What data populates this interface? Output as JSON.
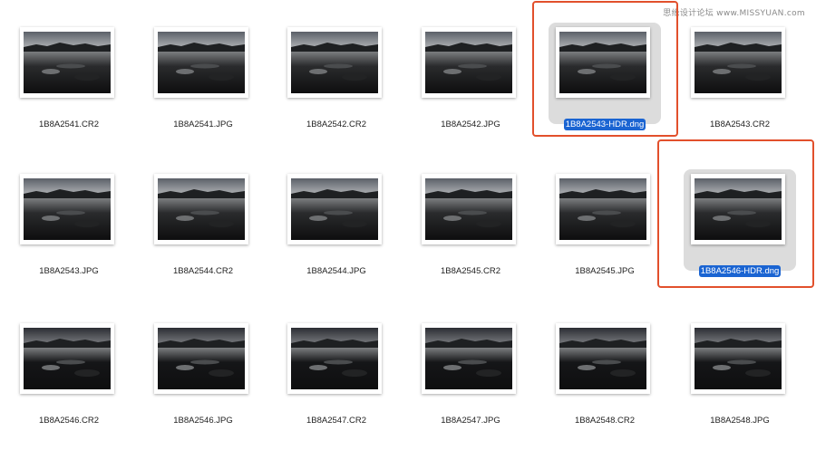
{
  "watermark": "思缘设计论坛 www.MISSYUAN.com",
  "files": [
    {
      "name": "1B8A2541.CR2",
      "selected": false
    },
    {
      "name": "1B8A2541.JPG",
      "selected": false
    },
    {
      "name": "1B8A2542.CR2",
      "selected": false
    },
    {
      "name": "1B8A2542.JPG",
      "selected": false
    },
    {
      "name": "1B8A2543-HDR.dng",
      "selected": true
    },
    {
      "name": "1B8A2543.CR2",
      "selected": false
    },
    {
      "name": "1B8A2543.JPG",
      "selected": false
    },
    {
      "name": "1B8A2544.CR2",
      "selected": false
    },
    {
      "name": "1B8A2544.JPG",
      "selected": false
    },
    {
      "name": "1B8A2545.CR2",
      "selected": false
    },
    {
      "name": "1B8A2545.JPG",
      "selected": false
    },
    {
      "name": "1B8A2546-HDR.dng",
      "selected": true
    },
    {
      "name": "1B8A2546.CR2",
      "selected": false
    },
    {
      "name": "1B8A2546.JPG",
      "selected": false
    },
    {
      "name": "1B8A2547.CR2",
      "selected": false
    },
    {
      "name": "1B8A2547.JPG",
      "selected": false
    },
    {
      "name": "1B8A2548.CR2",
      "selected": false
    },
    {
      "name": "1B8A2548.JPG",
      "selected": false
    }
  ],
  "colors": {
    "selection_label": "#1a64d2",
    "selection_tile": "#dcdcdc",
    "annotation_box": "#e2502c"
  }
}
